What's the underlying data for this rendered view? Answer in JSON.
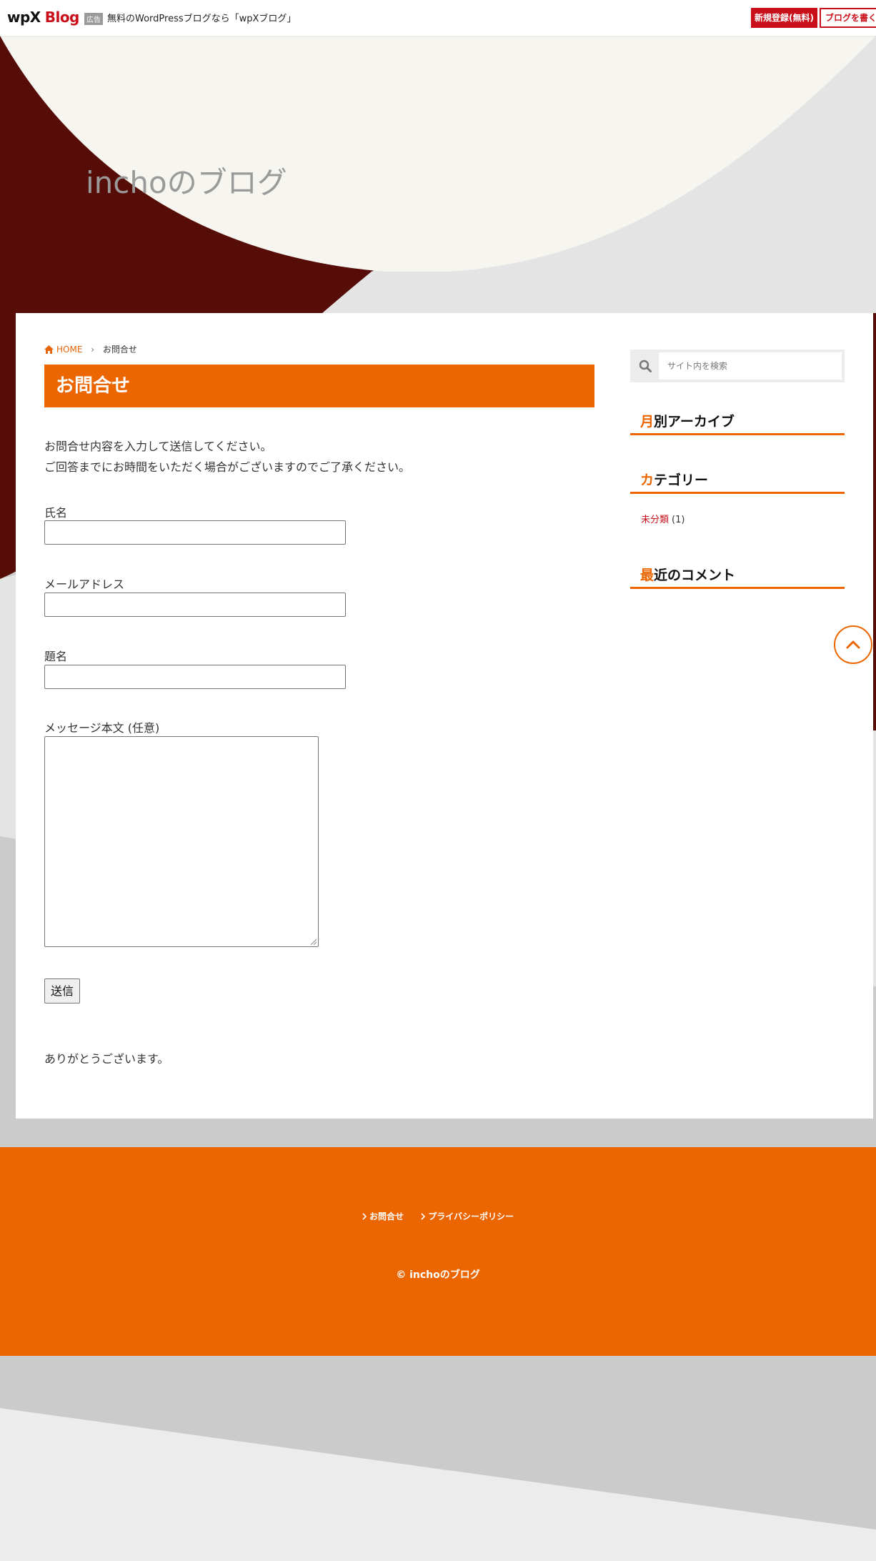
{
  "adbar": {
    "logo_wp": "wpX",
    "logo_blog": "Blog",
    "badge": "広告",
    "promo": "無料のWordPressブログなら「wpXブログ」",
    "signup_label": "新規登録(無料)",
    "write_label": "ブログを書く"
  },
  "site": {
    "title": "inchoのブログ"
  },
  "breadcrumb": {
    "home": "HOME",
    "current": "お問合せ"
  },
  "page": {
    "heading": "お問合せ",
    "intro_line1": "お問合せ内容を入力して送信してください。",
    "intro_line2": "ご回答までにお時間をいただく場合がございますのでご了承ください。"
  },
  "form": {
    "name_label": "氏名",
    "email_label": "メールアドレス",
    "subject_label": "題名",
    "message_label": "メッセージ本文 (任意)",
    "submit_label": "送信",
    "thanks": "ありがとうございます。"
  },
  "sidebar": {
    "search_placeholder": "サイト内を検索",
    "archive_first": "月",
    "archive_rest": "別アーカイブ",
    "category_first": "カ",
    "category_rest": "テゴリー",
    "category_item": "未分類",
    "category_count": "(1)",
    "comments_first": "最",
    "comments_rest": "近のコメント"
  },
  "footer": {
    "nav_contact": "お問合せ",
    "nav_privacy": "プライバシーポリシー",
    "copyright": "© inchoのブログ"
  },
  "colors": {
    "accent": "#eb6500",
    "brand_red": "#c9101a",
    "hero_dark": "#560c07"
  },
  "icons": [
    "home-icon",
    "chevron-right-icon",
    "search-icon",
    "chevron-up-icon"
  ]
}
